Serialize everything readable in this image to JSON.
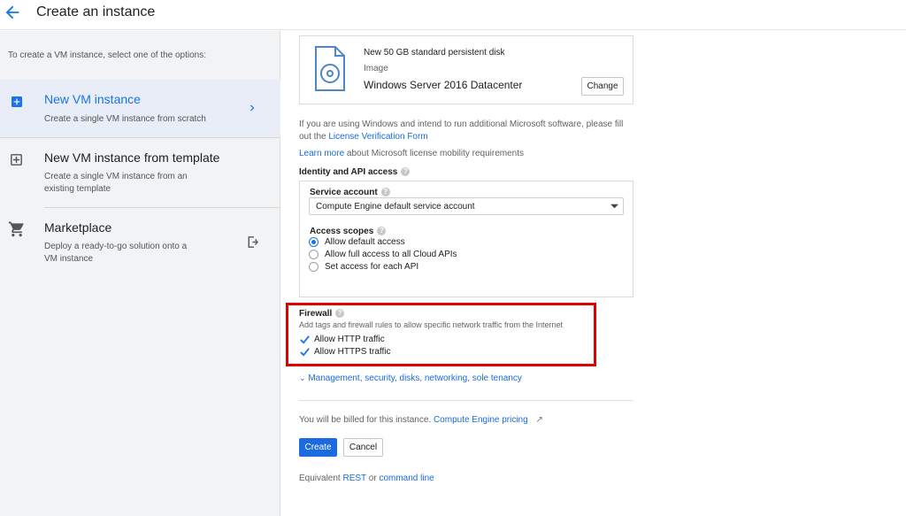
{
  "header": {
    "back_icon": "arrow-back-icon",
    "title": "Create an instance"
  },
  "sidebar": {
    "intro": "To create a VM instance, select one of the options:",
    "options": [
      {
        "title": "New VM instance",
        "desc": "Create a single VM instance from scratch",
        "icon": "add-box-icon",
        "selected": true
      },
      {
        "title": "New VM instance from template",
        "desc": "Create a single VM instance from an existing template",
        "icon": "add-box-outline-icon"
      },
      {
        "title": "Marketplace",
        "desc": "Deploy a ready-to-go solution onto a VM instance",
        "icon": "cart-icon"
      }
    ]
  },
  "boot_disk": {
    "disk_label": "New 50 GB standard persistent disk",
    "image_label": "Image",
    "image_value": "Windows Server 2016 Datacenter",
    "change_label": "Change"
  },
  "license": {
    "text": "If you are using Windows and intend to run additional Microsoft software, please fill out the",
    "link": "License Verification Form",
    "learn_more": "Learn more",
    "learn_more_rest": "about Microsoft license mobility requirements"
  },
  "identity": {
    "heading": "Identity and API access",
    "service_account_label": "Service account",
    "service_account_value": "Compute Engine default service account",
    "access_scopes_label": "Access scopes",
    "scopes": [
      {
        "label": "Allow default access",
        "selected": true
      },
      {
        "label": "Allow full access to all Cloud APIs",
        "selected": false
      },
      {
        "label": "Set access for each API",
        "selected": false
      }
    ]
  },
  "firewall": {
    "heading": "Firewall",
    "desc": "Add tags and firewall rules to allow specific network traffic from the Internet",
    "http_label": "Allow HTTP traffic",
    "https_label": "Allow HTTPS traffic",
    "http_checked": true,
    "https_checked": true,
    "highlight_color": "#e10000"
  },
  "management_link": "Management, security, disks, networking, sole tenancy",
  "billing": {
    "text": "You will be billed for this instance.",
    "link": "Compute Engine pricing"
  },
  "actions": {
    "create": "Create",
    "cancel": "Cancel"
  },
  "equivalent": {
    "prefix": "Equivalent",
    "rest": "REST",
    "or": "or",
    "command_line": "command line"
  },
  "colors": {
    "accent": "#1a73e8",
    "link": "#1a6be0",
    "create_button": "#1a6be0"
  }
}
